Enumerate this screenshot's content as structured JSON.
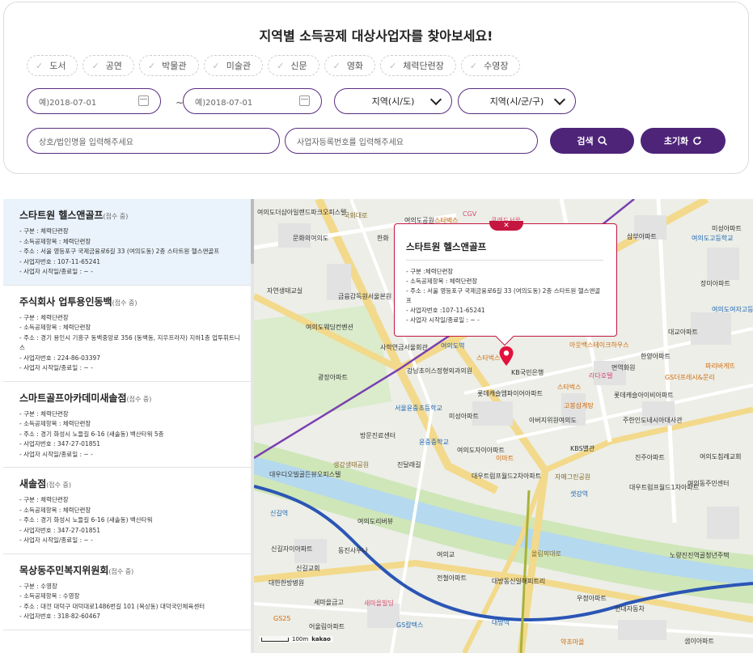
{
  "search": {
    "title": "지역별 소득공제 대상사업자를 찾아보세요!",
    "categories": [
      "도서",
      "공연",
      "박물관",
      "미술관",
      "신문",
      "영화",
      "체력단련장",
      "수영장"
    ],
    "date_start_placeholder": "예)2018-07-01",
    "date_end_placeholder": "예)2018-07-01",
    "tilde": "~",
    "region_si": "지역(시/도)",
    "region_gu": "지역(시/군/구)",
    "business_name_placeholder": "상호/법인명을 입력해주세요",
    "business_number_placeholder": "사업자등록번호를 입력해주세요",
    "search_button": "검색",
    "reset_button": "초기화"
  },
  "results": [
    {
      "name": "스타트원 헬스앤골프",
      "badge": "(접수 중)",
      "lines": [
        "- 구분 : 체력단련장",
        "- 소득공제항목 : 체력단련장",
        "- 주소 : 서울 영등포구 국제금융로6길 33 (여의도동) 2층 스타트원 헬스앤골프",
        "- 사업자번호 : 107-11-65241",
        "- 사업자 시작일/종료일 : ~ -"
      ]
    },
    {
      "name": "주식회사 업투용인동백",
      "badge": "(접수 중)",
      "lines": [
        "- 구분 : 체력단련장",
        "- 소득공제항목 : 체력단련장",
        "- 주소 : 경기 용인시 기흥구 동백중앙로 356 (동백동, 지우프라자) 지하1층 업투휘트니스",
        "- 사업자번호 : 224-86-03397",
        "- 사업자 시작일/종료일 : ~ -"
      ]
    },
    {
      "name": "스마트골프아카데미새솔점",
      "badge": "(접수 중)",
      "lines": [
        "- 구분 : 체력단련장",
        "- 소득공제항목 : 체력단련장",
        "- 주소 : 경기 화성시 노들길 6-16 (새솔동) 백산타워 5층",
        "- 사업자번호 : 347-27-01851",
        "- 사업자 시작일/종료일 : ~ -"
      ]
    },
    {
      "name": "새솔점",
      "badge": "(접수 중)",
      "lines": [
        "- 구분 : 체력단련장",
        "- 소득공제항목 : 체력단련장",
        "- 주소 : 경기 화성시 노들길 6-16 (새솔동) 백산타워",
        "- 사업자번호 : 347-27-01851",
        "- 사업자 시작일/종료일 : ~ -"
      ]
    },
    {
      "name": "목상동주민복지위원회",
      "badge": "(접수 중)",
      "lines": [
        "- 구분 : 수영장",
        "- 소득공제항목 : 수영장",
        "- 주소 : 대전 대덕구 대덕대로1486번길 101 (목상동) 대덕국민체육센터",
        "- 사업자번호 : 318-82-60467"
      ]
    }
  ],
  "popup": {
    "close": "✕",
    "title": "스타트원 헬스앤골프",
    "lines": [
      "- 구분 :체력단련장",
      "- 소득공제항목 : 체력단련장",
      "- 주소 : 서울 영등포구 국제금융로6길 33 (여의도동) 2층 스타트원 헬스앤골프",
      "- 사업자번호 :107-11-65241",
      "- 사업자 시작일/종료일 : ~ -"
    ]
  },
  "map": {
    "scale": "100m",
    "brand": "kakao",
    "labels": [
      {
        "t": "여의도더샵아일랜드파크오피스텔",
        "c": ""
      },
      {
        "t": "문화의여의도",
        "c": ""
      },
      {
        "t": "한화",
        "c": ""
      },
      {
        "t": "여의도공원",
        "c": ""
      },
      {
        "t": "국회대로",
        "c": "road"
      },
      {
        "t": "CGV",
        "c": "pink"
      },
      {
        "t": "스타벅스",
        "c": "poi"
      },
      {
        "t": "콘래드서울",
        "c": "pink"
      },
      {
        "t": "삼부아파트",
        "c": ""
      },
      {
        "t": "여의도고등학교",
        "c": "sub"
      },
      {
        "t": "미성아파트",
        "c": ""
      },
      {
        "t": "자연생태교실",
        "c": ""
      },
      {
        "t": "금융감독원서울본원",
        "c": ""
      },
      {
        "t": "여의도웨딩컨벤션",
        "c": ""
      },
      {
        "t": "사학연금서울회관",
        "c": ""
      },
      {
        "t": "여의도역",
        "c": "sub"
      },
      {
        "t": "스타벅스",
        "c": "poi"
      },
      {
        "t": "KB국민은행",
        "c": ""
      },
      {
        "t": "아웃백스테이크하우스",
        "c": "poi"
      },
      {
        "t": "한양아파트",
        "c": ""
      },
      {
        "t": "대교아파트",
        "c": ""
      },
      {
        "t": "장미아파트",
        "c": ""
      },
      {
        "t": "광장아파트",
        "c": ""
      },
      {
        "t": "강남초이스정형외과의원",
        "c": ""
      },
      {
        "t": "롯데캐슬엠파이어아파트",
        "c": ""
      },
      {
        "t": "스타벅스",
        "c": "poi"
      },
      {
        "t": "고봉삼계탕",
        "c": "poi"
      },
      {
        "t": "롯데캐슬아이비아파트",
        "c": ""
      },
      {
        "t": "서울윤중초등학교",
        "c": "sub"
      },
      {
        "t": "미성아파트",
        "c": ""
      },
      {
        "t": "아버지위원여의도",
        "c": ""
      },
      {
        "t": "주한인도네시아대사관",
        "c": ""
      },
      {
        "t": "방문진료센터",
        "c": ""
      },
      {
        "t": "윤중중학교",
        "c": "sub"
      },
      {
        "t": "여의도자이아파트",
        "c": ""
      },
      {
        "t": "KBS별관",
        "c": ""
      },
      {
        "t": "진주아파트",
        "c": ""
      },
      {
        "t": "여의도침례교회",
        "c": ""
      },
      {
        "t": "대우디오빌골든뷰오피스텔",
        "c": ""
      },
      {
        "t": "생강생태공원",
        "c": "road"
      },
      {
        "t": "진달래길",
        "c": ""
      },
      {
        "t": "대우트럼프월드2차아파트",
        "c": ""
      },
      {
        "t": "자매그린공원",
        "c": "road"
      },
      {
        "t": "대우트럼프월드1차아파트",
        "c": ""
      },
      {
        "t": "여의동주민센터",
        "c": ""
      },
      {
        "t": "샛강역",
        "c": "sub"
      },
      {
        "t": "여의도리버뷰",
        "c": ""
      },
      {
        "t": "신길역",
        "c": "sub"
      },
      {
        "t": "동진사우나",
        "c": ""
      },
      {
        "t": "여의교",
        "c": ""
      },
      {
        "t": "신길자이아파트",
        "c": ""
      },
      {
        "t": "신길교회",
        "c": ""
      },
      {
        "t": "대한한방병원",
        "c": ""
      },
      {
        "t": "전철아파트",
        "c": ""
      },
      {
        "t": "대방동신일해피트리",
        "c": ""
      },
      {
        "t": "우정아파트",
        "c": ""
      },
      {
        "t": "노량진진역골청년주택",
        "c": ""
      },
      {
        "t": "세마을금고",
        "c": ""
      },
      {
        "t": "새마을빌딩",
        "c": "pink"
      },
      {
        "t": "대방역",
        "c": "sub"
      },
      {
        "t": "현대자동차",
        "c": ""
      },
      {
        "t": "어울림아파트",
        "c": ""
      },
      {
        "t": "GS칼텍스",
        "c": "sub"
      },
      {
        "t": "약초마을",
        "c": "poi"
      },
      {
        "t": "샘이아파트",
        "c": ""
      },
      {
        "t": "GS25",
        "c": "poi"
      },
      {
        "t": "올림픽대로",
        "c": "road"
      },
      {
        "t": "GS더프레시&문리",
        "c": "poi"
      },
      {
        "t": "파리바게뜨",
        "c": "poi"
      },
      {
        "t": "라다호텔",
        "c": "pink"
      },
      {
        "t": "면역화원",
        "c": ""
      },
      {
        "t": "이마트",
        "c": "poi"
      },
      {
        "t": "여의도여자고등학교",
        "c": "sub"
      }
    ]
  }
}
